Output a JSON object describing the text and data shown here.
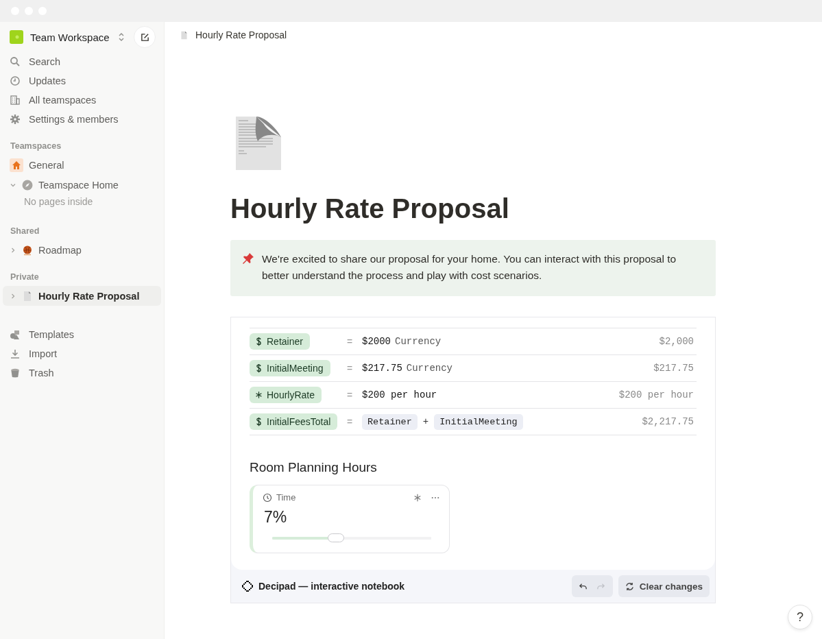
{
  "sidebar": {
    "workspace": {
      "name": "Team Workspace"
    },
    "nav": [
      {
        "label": "Search",
        "kind": "search"
      },
      {
        "label": "Updates",
        "kind": "clock"
      },
      {
        "label": "All teamspaces",
        "kind": "building"
      },
      {
        "label": "Settings & members",
        "kind": "gear"
      }
    ],
    "sections": [
      {
        "title": "Teamspaces",
        "items": [
          {
            "label": "General",
            "kind": "home",
            "selected": false,
            "has_toggle": false
          },
          {
            "label": "Teamspace Home",
            "kind": "compass",
            "expanded": true,
            "selected": false,
            "has_toggle": true,
            "empty_text": "No pages inside"
          }
        ]
      },
      {
        "title": "Shared",
        "items": [
          {
            "label": "Roadmap",
            "kind": "ball",
            "expanded": false,
            "selected": false,
            "has_toggle": true
          }
        ]
      },
      {
        "title": "Private",
        "items": [
          {
            "label": "Hourly Rate Proposal",
            "kind": "doc",
            "expanded": false,
            "selected": true,
            "has_toggle": true
          }
        ]
      }
    ],
    "footer": [
      {
        "label": "Templates",
        "kind": "shapes"
      },
      {
        "label": "Import",
        "kind": "download"
      },
      {
        "label": "Trash",
        "kind": "trash"
      }
    ]
  },
  "breadcrumb": "Hourly Rate Proposal",
  "page": {
    "title": "Hourly Rate Proposal",
    "callout": "We're excited to share our proposal for your home. You can interact with this proposal to better understand the process and play with cost scenarios.",
    "variables": [
      {
        "name": "Retainer",
        "kind": "currency",
        "equals": "=",
        "formula": [
          {
            "kind": "literal",
            "value": "$2000",
            "unit": "Currency"
          }
        ],
        "result": "$2,000"
      },
      {
        "name": "InitialMeeting",
        "kind": "currency",
        "equals": "=",
        "formula": [
          {
            "kind": "literal",
            "value": "$217.75",
            "unit": "Currency"
          }
        ],
        "result": "$217.75"
      },
      {
        "name": "HourlyRate",
        "kind": "number",
        "equals": "=",
        "formula": [
          {
            "kind": "literal",
            "value": "$200 per hour"
          }
        ],
        "result": "$200 per hour"
      },
      {
        "name": "InitialFeesTotal",
        "kind": "currency",
        "equals": "=",
        "formula": [
          {
            "kind": "ref",
            "value": "Retainer"
          },
          {
            "kind": "op",
            "value": "+"
          },
          {
            "kind": "ref",
            "value": "InitialMeeting"
          }
        ],
        "result": "$2,217.75"
      }
    ],
    "section_heading": "Room Planning Hours",
    "slider": {
      "label": "Time",
      "value": "7%",
      "level": 0.4
    }
  },
  "notebook_bar": {
    "brand": "Decipad — interactive notebook",
    "undo_disabled": false,
    "redo_disabled": true,
    "clear_label": "Clear changes"
  },
  "help": "?"
}
